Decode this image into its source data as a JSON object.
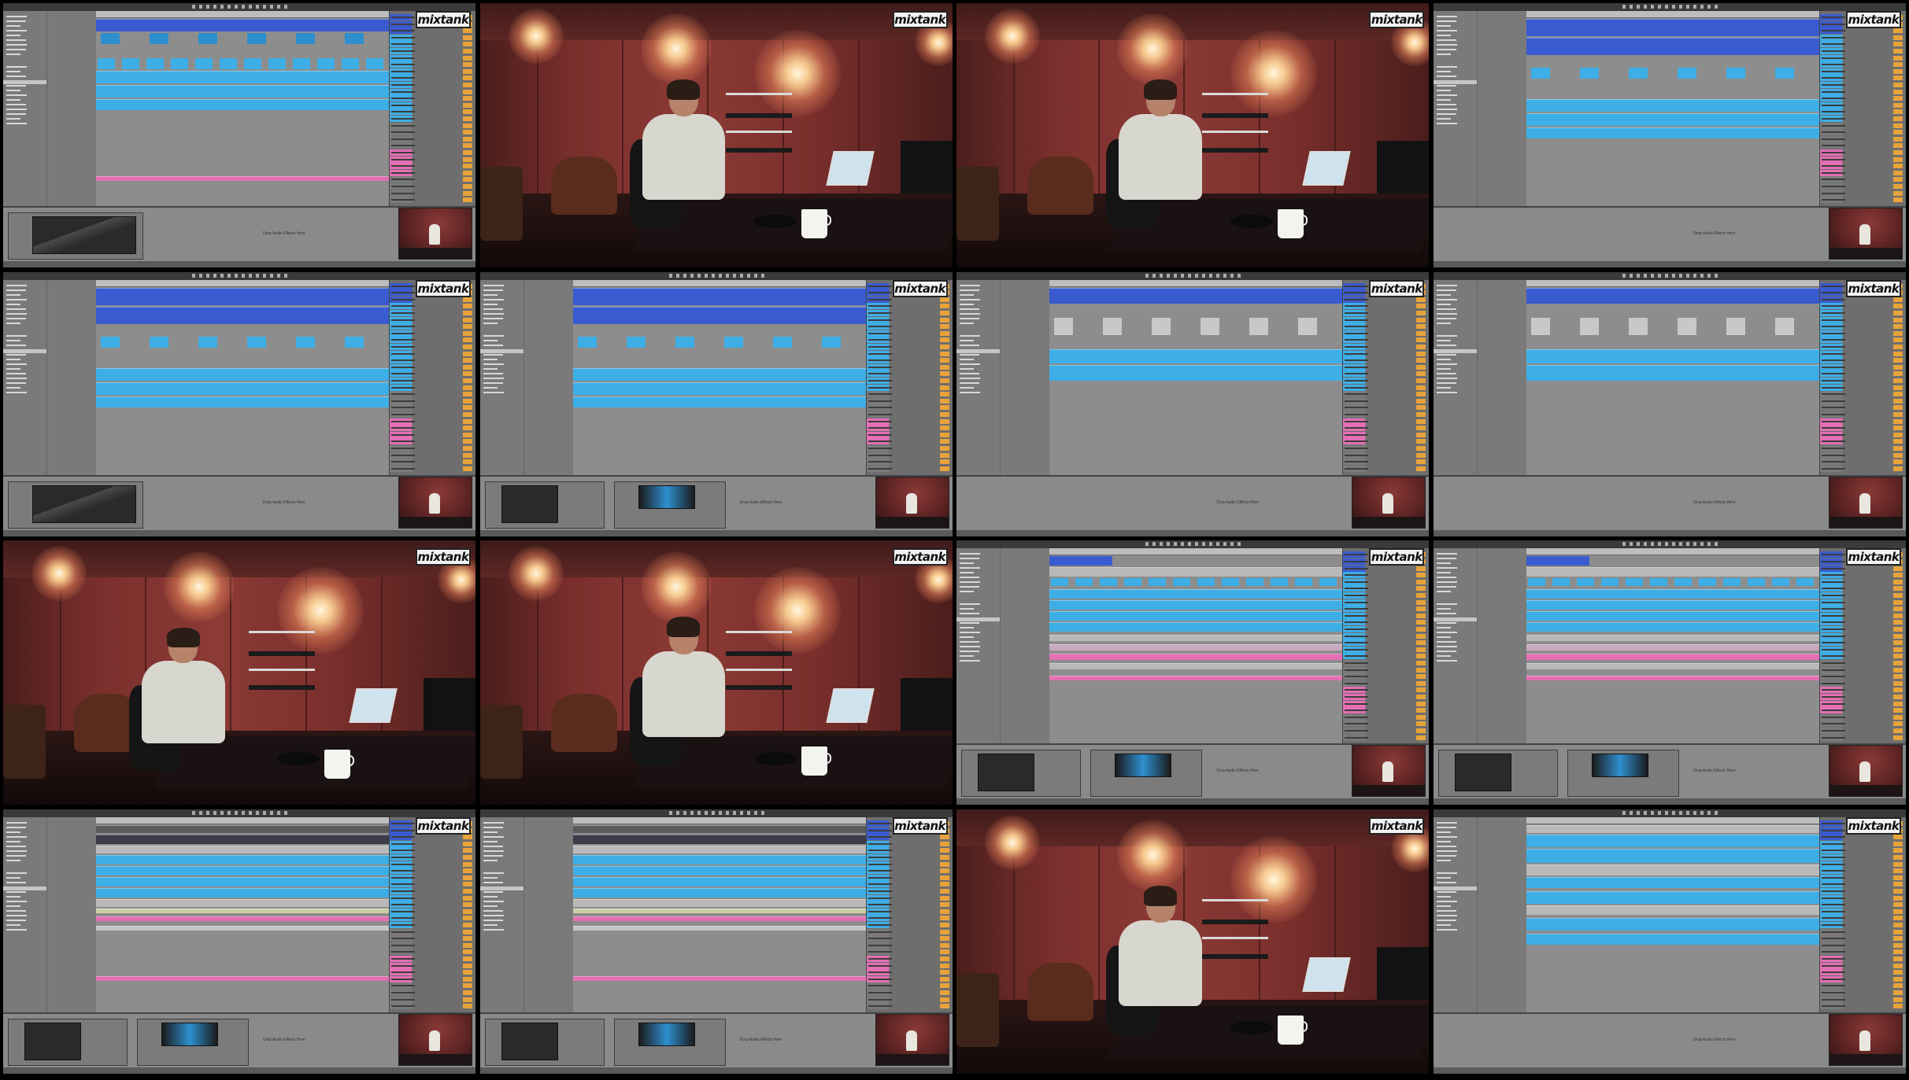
{
  "logo_text": "mixtank",
  "daw_hint": "Drop Audio Effects Here",
  "frames": [
    {
      "type": "daw",
      "variant": "a",
      "device": "eq"
    },
    {
      "type": "studio",
      "pose": "typing"
    },
    {
      "type": "studio",
      "pose": "typing"
    },
    {
      "type": "daw",
      "variant": "b",
      "device": "none"
    },
    {
      "type": "daw",
      "variant": "b",
      "device": "eq"
    },
    {
      "type": "daw",
      "variant": "b",
      "device": "comp"
    },
    {
      "type": "daw",
      "variant": "c",
      "device": "none"
    },
    {
      "type": "daw",
      "variant": "c",
      "device": "none"
    },
    {
      "type": "studio",
      "pose": "gesturing"
    },
    {
      "type": "studio",
      "pose": "typing"
    },
    {
      "type": "daw",
      "variant": "d",
      "device": "comp"
    },
    {
      "type": "daw",
      "variant": "d",
      "device": "comp"
    },
    {
      "type": "daw",
      "variant": "e",
      "device": "comp"
    },
    {
      "type": "daw",
      "variant": "e",
      "device": "comp"
    },
    {
      "type": "studio",
      "pose": "typing"
    },
    {
      "type": "daw",
      "variant": "f",
      "device": "none"
    }
  ],
  "colors": {
    "clip_dark_blue": "#3a5bd0",
    "clip_light_blue": "#3eaee6",
    "clip_mid_blue": "#2d8fd0",
    "clip_pink": "#e46fb4",
    "clip_orange": "#e7a33a",
    "wall_red": "#8c3a35"
  }
}
